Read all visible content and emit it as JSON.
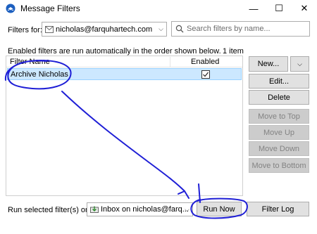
{
  "window": {
    "title": "Message Filters",
    "controls": {
      "minimize": "—",
      "maximize": "☐",
      "close": "✕"
    }
  },
  "filters_for": {
    "label": "Filters for:",
    "account": "nicholas@farquhartech.com",
    "search_placeholder": "Search filters by name..."
  },
  "info": {
    "text": "Enabled filters are run automatically in the order shown below.",
    "count": "1 item"
  },
  "list": {
    "columns": {
      "name": "Filter Name",
      "enabled": "Enabled"
    },
    "rows": [
      {
        "name": "Archive Nicholas",
        "enabled": true,
        "selected": true
      }
    ]
  },
  "buttons": {
    "new": "New...",
    "edit": "Edit...",
    "delete": "Delete",
    "move_to_top": "Move to Top",
    "move_up": "Move Up",
    "move_down": "Move Down",
    "move_to_bottom": "Move to Bottom"
  },
  "footer": {
    "run_label": "Run selected filter(s) on:",
    "folder": "Inbox on nicholas@farq...",
    "run_now": "Run Now",
    "filter_log": "Filter Log"
  },
  "colors": {
    "selection": "#cce8ff",
    "annotation": "#1f1fd6",
    "disabled_button": "#cccccc"
  },
  "icons": {
    "app": "thunderbird-icon",
    "search": "search-icon",
    "account": "envelope-icon",
    "folder": "inbox-folder-icon"
  }
}
